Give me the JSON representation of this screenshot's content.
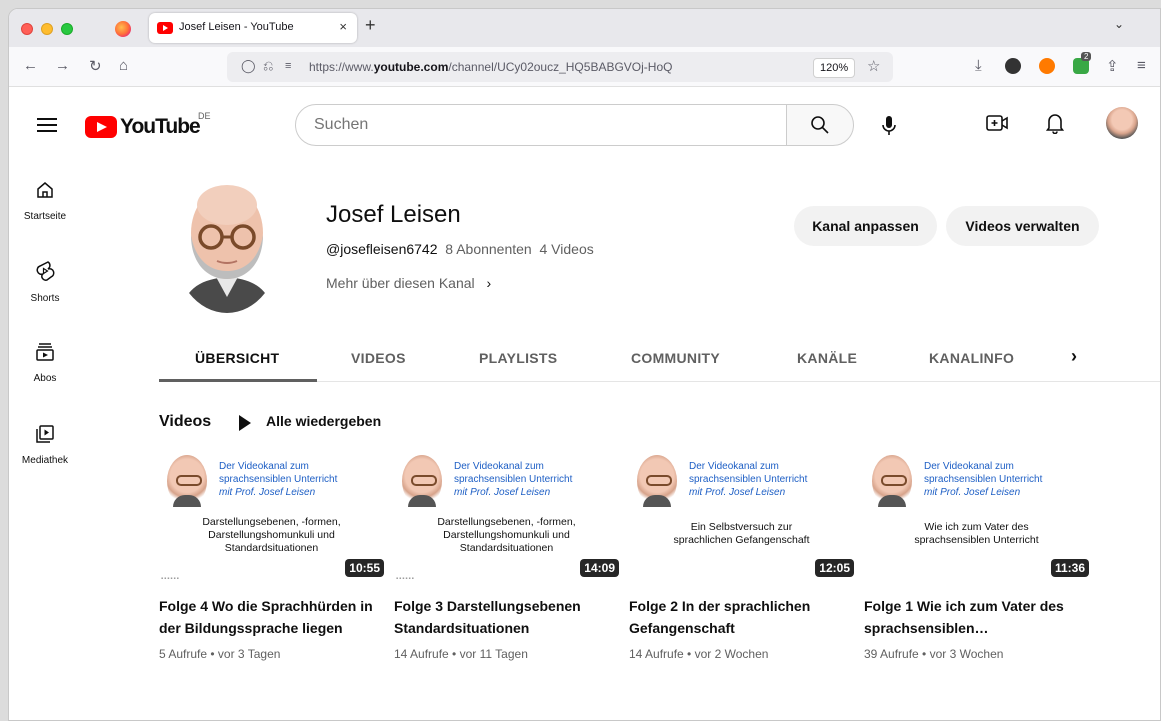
{
  "browser": {
    "tab_title": "Josef Leisen - YouTube",
    "tab_close": "×",
    "new_tab": "+",
    "url_prefix": "https://www.",
    "url_domain": "youtube.com",
    "url_path": "/channel/UCy02oucz_HQ5BABGVOj-HoQ",
    "zoom": "120%",
    "ext_badge": "2"
  },
  "header": {
    "logo_text": "YouTube",
    "logo_region": "DE",
    "search_placeholder": "Suchen"
  },
  "sidebar": {
    "items": [
      {
        "label": "Startseite",
        "icon": "home-icon"
      },
      {
        "label": "Shorts",
        "icon": "shorts-icon"
      },
      {
        "label": "Abos",
        "icon": "subscriptions-icon"
      },
      {
        "label": "Mediathek",
        "icon": "library-icon"
      }
    ]
  },
  "channel": {
    "name": "Josef Leisen",
    "handle": "@josefleisen6742",
    "subscribers": "8 Abonnenten",
    "videos_count": "4 Videos",
    "more_link": "Mehr über diesen Kanal",
    "customize_button": "Kanal anpassen",
    "manage_button": "Videos verwalten"
  },
  "tabs": [
    "ÜBERSICHT",
    "VIDEOS",
    "PLAYLISTS",
    "COMMUNITY",
    "KANÄLE",
    "KANALINFO"
  ],
  "videos_section": {
    "title": "Videos",
    "play_all": "Alle wiedergeben"
  },
  "thumb_brand": {
    "line1": "Der Videokanal zum",
    "line2": "sprachsensiblen Unterricht",
    "line3": "mit Prof. Josef Leisen"
  },
  "videos": [
    {
      "thumb_line1": "Darstellungsebenen, -formen,",
      "thumb_line2": "Darstellungshomunkuli und",
      "thumb_line3": "Standardsituationen",
      "duration": "10:55",
      "title": "Folge 4 Wo die Sprachhürden in der Bildungssprache liegen",
      "views": "5 Aufrufe",
      "age": "vor 3 Tagen"
    },
    {
      "thumb_line1": "Darstellungsebenen, -formen,",
      "thumb_line2": "Darstellungshomunkuli und",
      "thumb_line3": "Standardsituationen",
      "duration": "14:09",
      "title": "Folge 3 Darstellungsebenen Standardsituationen",
      "views": "14 Aufrufe",
      "age": "vor 11 Tagen"
    },
    {
      "thumb_line1": "Ein Selbstversuch zur",
      "thumb_line2": "sprachlichen Gefangenschaft",
      "thumb_line3": "",
      "duration": "12:05",
      "title": "Folge 2 In der sprachlichen Gefangenschaft",
      "views": "14 Aufrufe",
      "age": "vor 2 Wochen"
    },
    {
      "thumb_line1": "Wie ich zum Vater des",
      "thumb_line2": "sprachsensiblen Unterricht",
      "thumb_line3": "",
      "duration": "11:36",
      "title": "Folge 1 Wie ich zum Vater des sprachsensiblen…",
      "views": "39 Aufrufe",
      "age": "vor 3 Wochen"
    }
  ]
}
